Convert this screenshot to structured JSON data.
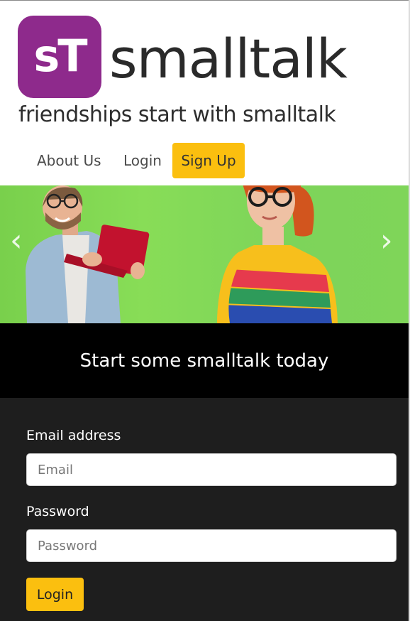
{
  "header": {
    "logo_letters": "sT",
    "brand_name": "smalltalk",
    "tagline": "friendships start with smalltalk"
  },
  "nav": {
    "about": "About Us",
    "login": "Login",
    "signup": "Sign Up"
  },
  "carousel": {
    "prev_symbol": "‹",
    "next_symbol": "›"
  },
  "banner": {
    "text": "Start some smalltalk today"
  },
  "form": {
    "email_label": "Email address",
    "email_placeholder": "Email",
    "password_label": "Password",
    "password_placeholder": "Password",
    "submit": "Login"
  },
  "colors": {
    "logo_purple": "#8e2a8c",
    "accent_yellow": "#fbbf0f",
    "carousel_green": "#82d555",
    "banner_black": "#000000",
    "form_bg": "#1e1e1e"
  }
}
